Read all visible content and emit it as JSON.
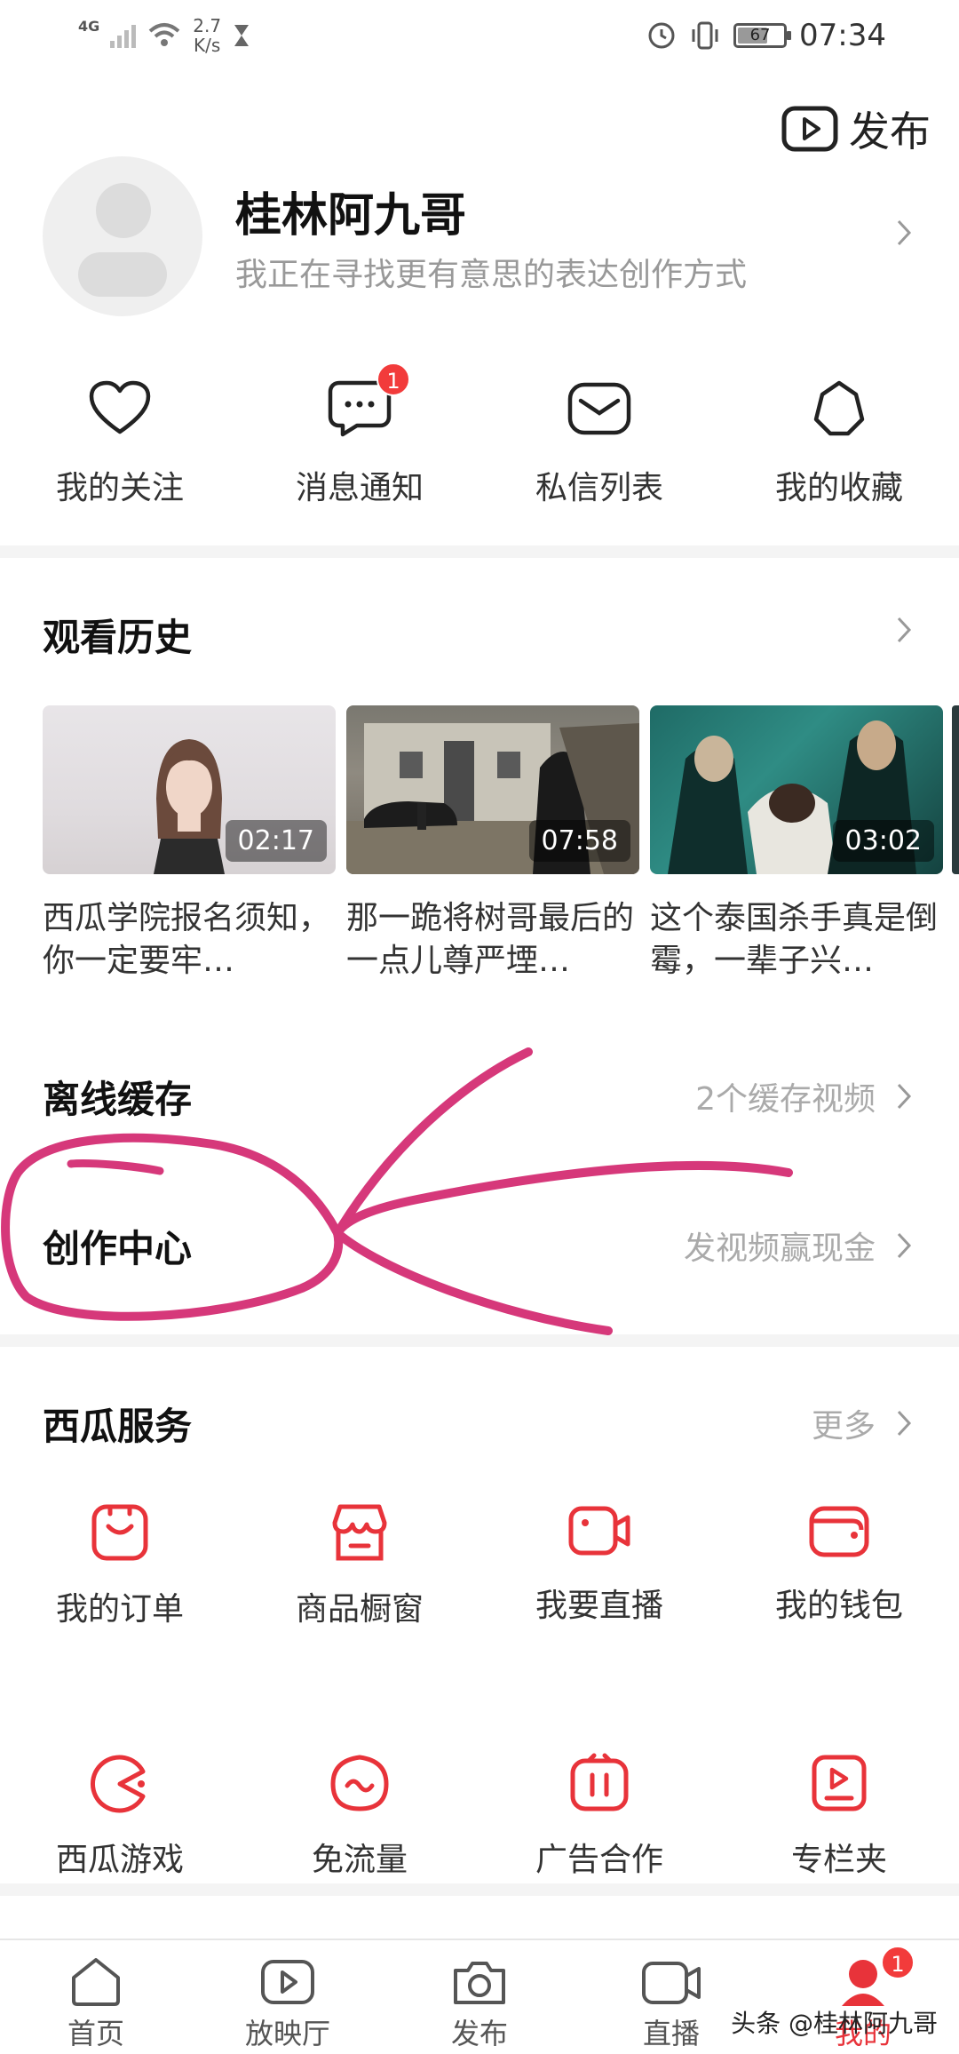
{
  "status_bar": {
    "network": "4G",
    "speed": "2.7",
    "speed_unit": "K/s",
    "battery": "67",
    "time": "07:34"
  },
  "header": {
    "publish_label": "发布"
  },
  "profile": {
    "name": "桂林阿九哥",
    "bio": "我正在寻找更有意思的表达创作方式"
  },
  "quick_actions": [
    {
      "label": "我的关注",
      "icon": "heart-icon"
    },
    {
      "label": "消息通知",
      "icon": "chat-icon",
      "badge": "1"
    },
    {
      "label": "私信列表",
      "icon": "mail-icon"
    },
    {
      "label": "我的收藏",
      "icon": "star-icon"
    }
  ],
  "history": {
    "title": "观看历史",
    "items": [
      {
        "duration": "02:17",
        "title": "西瓜学院报名须知，你一定要牢…"
      },
      {
        "duration": "07:58",
        "title": "那一跪将树哥最后的一点儿尊严堙…"
      },
      {
        "duration": "03:02",
        "title": "这个泰国杀手真是倒霉，一辈子兴…"
      }
    ]
  },
  "offline": {
    "title": "离线缓存",
    "value": "2个缓存视频"
  },
  "creator": {
    "title": "创作中心",
    "value": "发视频赢现金"
  },
  "services": {
    "title": "西瓜服务",
    "more": "更多",
    "items": [
      {
        "label": "我的订单",
        "icon": "order-icon"
      },
      {
        "label": "商品橱窗",
        "icon": "shop-icon"
      },
      {
        "label": "我要直播",
        "icon": "live-camera-icon"
      },
      {
        "label": "我的钱包",
        "icon": "wallet-icon"
      },
      {
        "label": "西瓜游戏",
        "icon": "game-icon"
      },
      {
        "label": "免流量",
        "icon": "free-data-icon"
      },
      {
        "label": "广告合作",
        "icon": "ad-icon"
      },
      {
        "label": "专栏夹",
        "icon": "column-icon"
      }
    ]
  },
  "bottom_nav": {
    "items": [
      {
        "label": "首页",
        "icon": "home-icon"
      },
      {
        "label": "放映厅",
        "icon": "play-icon"
      },
      {
        "label": "发布",
        "icon": "camera-icon"
      },
      {
        "label": "直播",
        "icon": "video-icon"
      },
      {
        "label": "我的",
        "icon": "profile-icon",
        "badge": "1"
      }
    ],
    "active_index": 4
  },
  "watermark": "头条 @桂林阿九哥",
  "colors": {
    "accent": "#e8333a",
    "annotation": "#d6387a"
  }
}
